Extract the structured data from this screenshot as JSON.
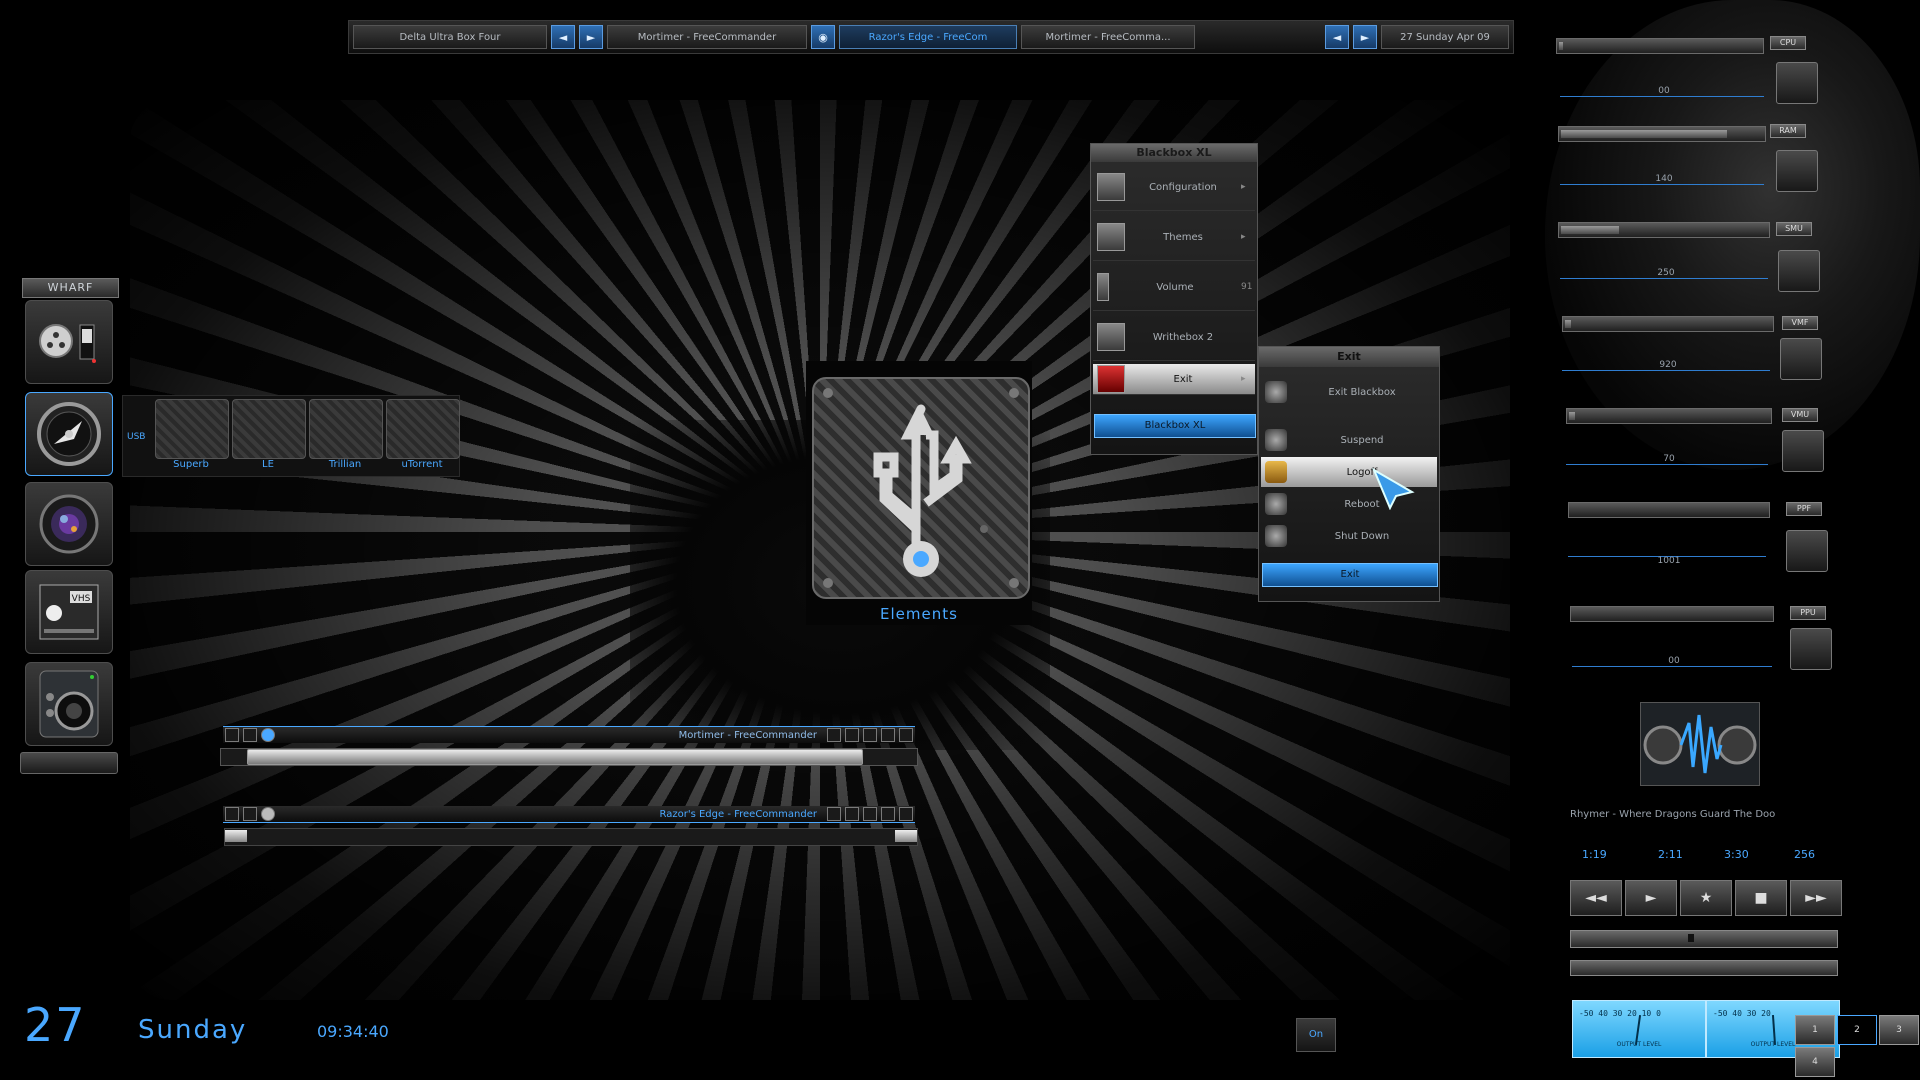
{
  "taskbar": {
    "workspace": "Delta Ultra Box Four",
    "tasks": [
      "Mortimer - FreeCommander",
      "Razor's Edge - FreeCom",
      "Mortimer - FreeComma..."
    ],
    "clock": "27 Sunday Apr 09"
  },
  "wharf": {
    "title": "WHARF",
    "items": [
      "control-panel-icon",
      "speed-gauge-icon",
      "camera-lens-icon",
      "vhs-tape-icon",
      "speaker-icon"
    ]
  },
  "usb_strip": {
    "lead_label": "USB",
    "tiles": [
      "Superb",
      "LE",
      "Trillian",
      "uTorrent"
    ]
  },
  "center_icon": {
    "label": "Elements",
    "icon": "usb-drive-icon"
  },
  "blackbox_menu": {
    "title": "Blackbox XL",
    "items": [
      {
        "label": "Configuration",
        "icon": "box-icon",
        "sub": "▸"
      },
      {
        "label": "Themes",
        "icon": "grid-icon",
        "sub": "▸"
      },
      {
        "label": "Volume",
        "icon": "slider-icon",
        "sub": "91"
      },
      {
        "label": "Writhebox 2",
        "icon": "pen-icon",
        "sub": ""
      },
      {
        "label": "Exit",
        "icon": "exit-icon",
        "sub": "▸"
      }
    ],
    "footer": "Blackbox XL"
  },
  "exit_menu": {
    "title": "Exit",
    "items": [
      {
        "label": "Exit Blackbox"
      },
      {
        "label": "Suspend"
      },
      {
        "label": "Logoff"
      },
      {
        "label": "Reboot"
      },
      {
        "label": "Shut Down"
      }
    ],
    "footer": "Exit"
  },
  "player1": {
    "title": "Mortimer - FreeCommander",
    "progress": 0.96
  },
  "player2": {
    "title": "Razor's Edge - FreeCommander",
    "progress": 0.98
  },
  "monitors": [
    {
      "tag": "CPU",
      "value": "00",
      "fill": 0.02
    },
    {
      "tag": "RAM",
      "value": "140",
      "fill": 0.82
    },
    {
      "tag": "SMU",
      "value": "250",
      "fill": 0.28
    },
    {
      "tag": "VMF",
      "value": "920",
      "fill": 0.03
    },
    {
      "tag": "VMU",
      "value": "70",
      "fill": 0.03
    },
    {
      "tag": "PPF",
      "value": "1001",
      "fill": 0.0
    },
    {
      "tag": "PPU",
      "value": "00",
      "fill": 0.0
    }
  ],
  "music": {
    "track": "Rhymer - Where Dragons Guard The Doo",
    "stats": [
      "1:19",
      "2:11",
      "3:30",
      "256"
    ],
    "controls": [
      "◄◄",
      "►",
      "★",
      "■",
      "►►"
    ],
    "position": 0.45
  },
  "vu": [
    {
      "label": "OUTPUT LEVEL",
      "scale": "-50 40 30 20 10 0"
    },
    {
      "label": "OUTPUT LEVEL",
      "scale": "-50 40 30 20"
    }
  ],
  "clock": {
    "day": "27",
    "weekday": "Sunday",
    "time": "09:34:40"
  },
  "bottom_button": "On",
  "pager": [
    "1",
    "2",
    "3",
    "4"
  ],
  "colors": {
    "accent": "#4aa8ff",
    "background": "#000000"
  }
}
